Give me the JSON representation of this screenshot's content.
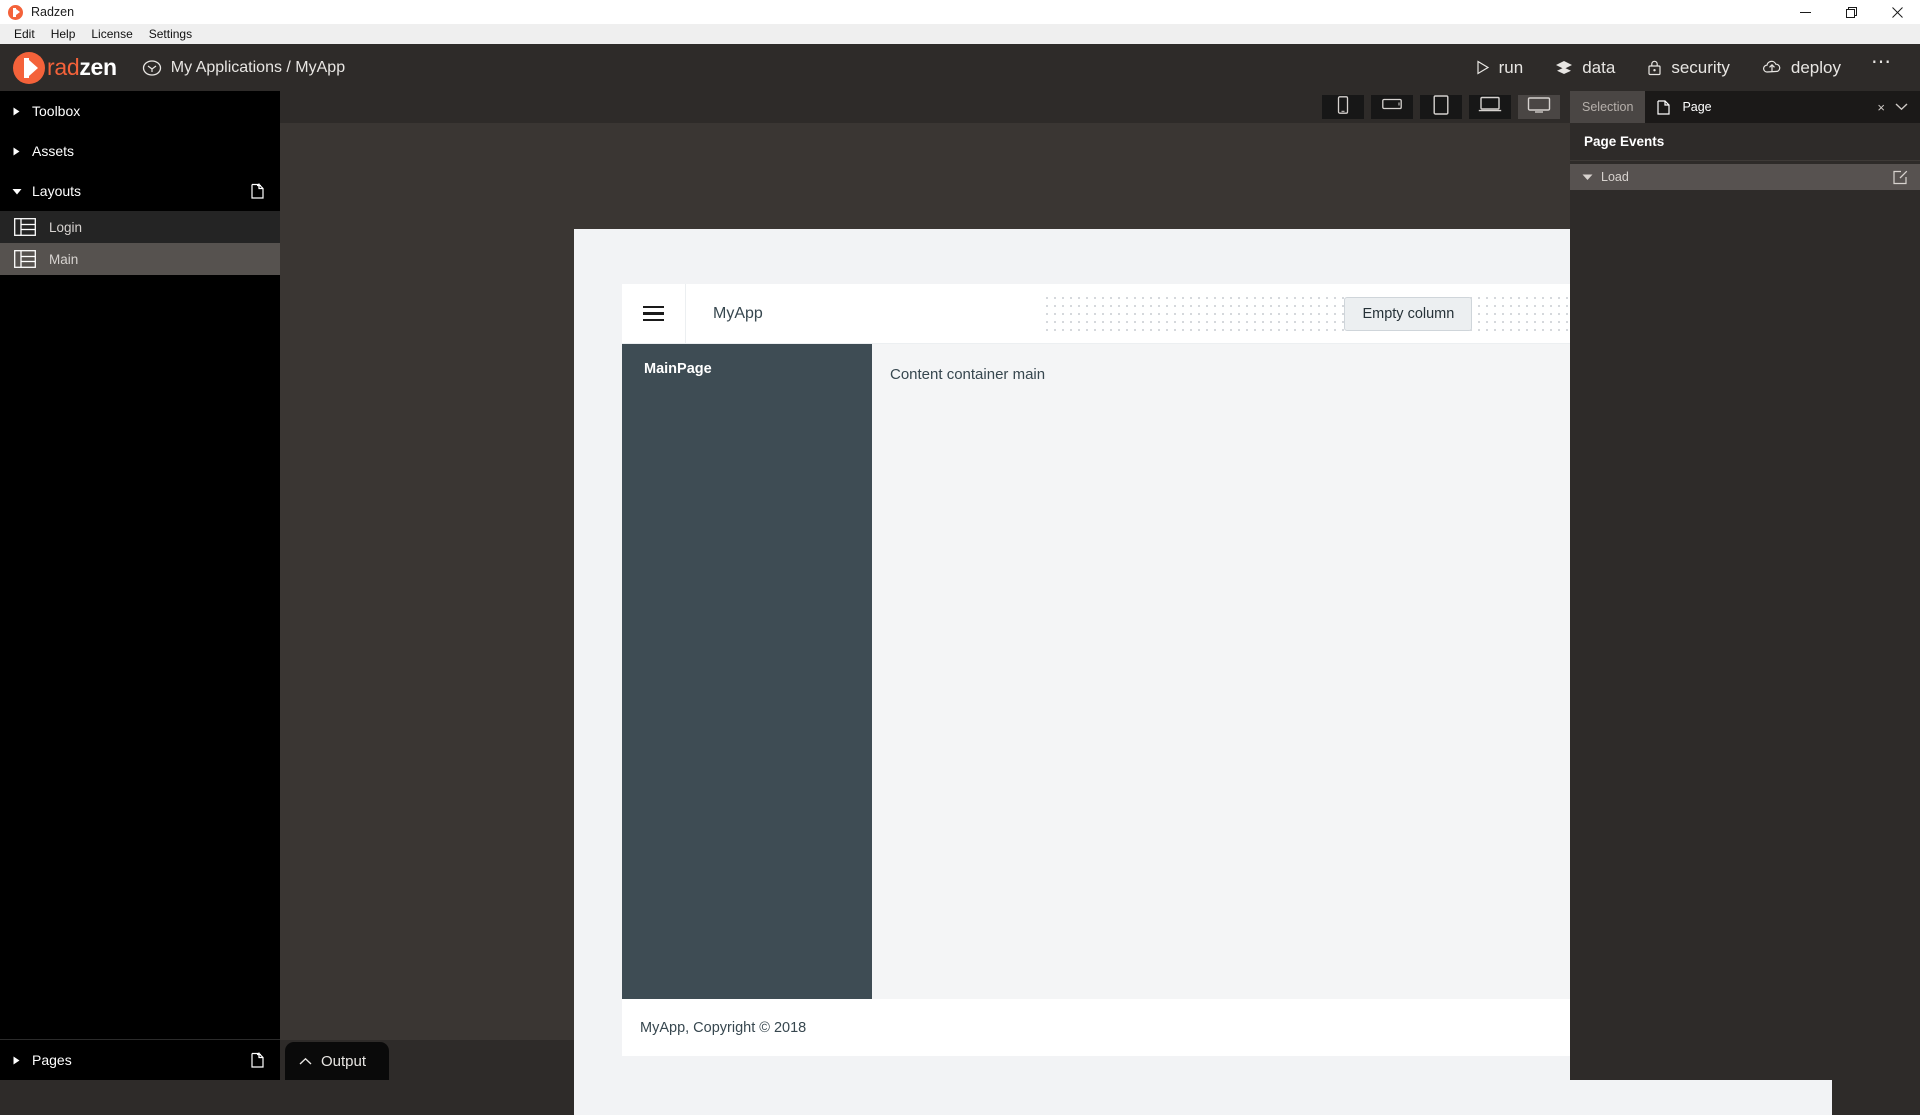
{
  "window": {
    "title": "Radzen",
    "controls": {
      "minimize": "minimize-icon",
      "maximize": "maximize-icon",
      "close": "close-icon"
    }
  },
  "menubar": {
    "items": [
      "Edit",
      "Help",
      "License",
      "Settings"
    ]
  },
  "app_header": {
    "logo_text_a": "rad",
    "logo_text_b": "zen",
    "breadcrumb": "My Applications / MyApp",
    "breadcrumb_icon": "app-circle-icon",
    "actions": [
      {
        "label": "run",
        "icon": "play-icon"
      },
      {
        "label": "data",
        "icon": "layers-icon"
      },
      {
        "label": "security",
        "icon": "lock-icon"
      },
      {
        "label": "deploy",
        "icon": "cloud-upload-icon"
      }
    ],
    "more": "⋯"
  },
  "sidebar": {
    "sections": [
      {
        "label": "Toolbox",
        "expanded": false,
        "icon": "chevron-right-icon"
      },
      {
        "label": "Assets",
        "expanded": false,
        "icon": "chevron-right-icon"
      },
      {
        "label": "Layouts",
        "expanded": true,
        "icon": "chevron-down-icon",
        "add_icon": "new-file-icon"
      }
    ],
    "layouts": [
      {
        "label": "Login",
        "selected": false,
        "icon": "layout-icon"
      },
      {
        "label": "Main",
        "selected": true,
        "icon": "layout-icon"
      }
    ],
    "footer": {
      "label": "Pages",
      "icon": "chevron-right-icon",
      "add_icon": "new-file-icon"
    }
  },
  "output_tab": {
    "label": "Output",
    "icon": "chevron-up-icon"
  },
  "device_toolbar": {
    "buttons": [
      {
        "name": "phone-portrait",
        "icon": "phone-portrait-icon",
        "active": false
      },
      {
        "name": "phone-landscape",
        "icon": "phone-landscape-icon",
        "active": false
      },
      {
        "name": "tablet",
        "icon": "tablet-icon",
        "active": false
      },
      {
        "name": "laptop",
        "icon": "laptop-icon",
        "active": false
      },
      {
        "name": "desktop",
        "icon": "desktop-icon",
        "active": true
      }
    ]
  },
  "canvas": {
    "app_title": "MyApp",
    "menu_icon": "hamburger-icon",
    "empty_column_label": "Empty column",
    "sidebar_label": "MainPage",
    "content_label": "Content container main",
    "footer_label": "MyApp, Copyright © 2018"
  },
  "right_panel": {
    "tab_inactive": "Selection",
    "tab_active": "Page",
    "tab_active_icon": "page-icon",
    "close_icon": "×",
    "collapse_icon": "chevron-down-icon",
    "section_title": "Page Events",
    "events": [
      {
        "label": "Load",
        "caret_icon": "caret-down-icon",
        "edit_icon": "edit-icon"
      }
    ]
  },
  "colors": {
    "accent": "#f4623a",
    "header_bg": "#2e2b29",
    "sidebar_bg": "#000000",
    "selected_item": "#56524f",
    "app_side_bg": "#3e4c54"
  }
}
